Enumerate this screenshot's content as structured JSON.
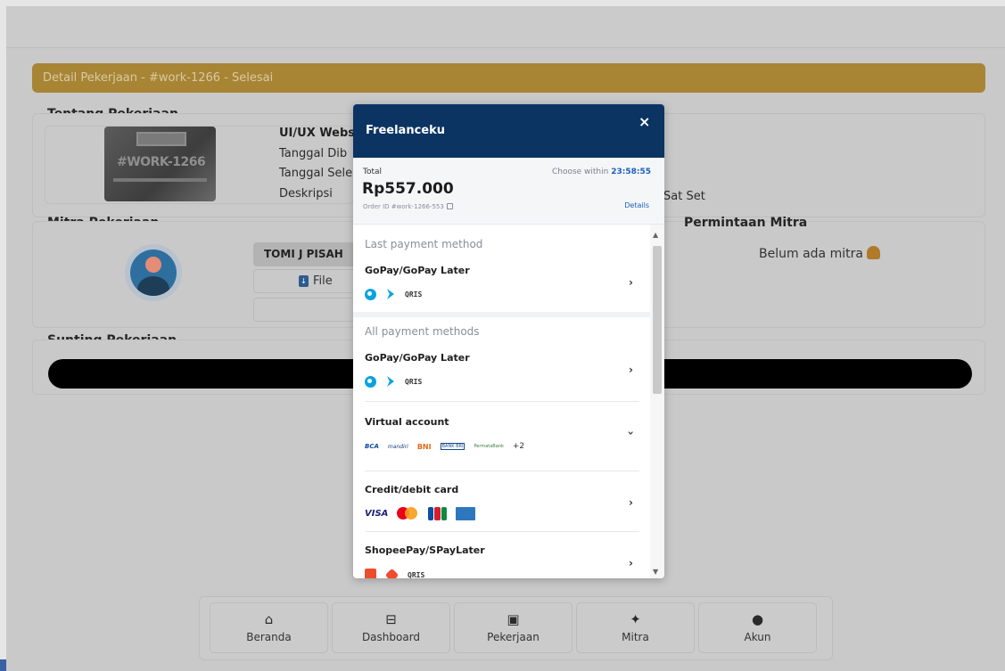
{
  "header": {
    "title": "Detail Pekerjaan - #work-1266 - Selesai"
  },
  "about": {
    "section_title": "Tentang Pekerjaan",
    "thumbnail_watermark": "#WORK-1266",
    "job_title": "UI/UX Webs",
    "date_created_label": "Tanggal Dib",
    "date_finished_label": "Tanggal Sele",
    "description_label": "Deskripsi",
    "description_tail": "Sat Set"
  },
  "partner": {
    "section_title": "Mitra Pekerjaan",
    "name": "TOMI J PISAH",
    "file_label": "File"
  },
  "requests": {
    "section_title": "Permintaan Mitra",
    "empty_text": "Belum ada mitra"
  },
  "edit": {
    "section_title": "Sunting Pekerjaan"
  },
  "bottom_nav": [
    {
      "label": "Beranda",
      "icon": "home-icon"
    },
    {
      "label": "Dashboard",
      "icon": "dashboard-icon"
    },
    {
      "label": "Pekerjaan",
      "icon": "briefcase-icon"
    },
    {
      "label": "Mitra",
      "icon": "handshake-icon"
    },
    {
      "label": "Akun",
      "icon": "account-icon"
    }
  ],
  "modal": {
    "merchant": "Freelanceku",
    "close_label": "×",
    "total_label": "Total",
    "choose_within_label": "Choose within",
    "countdown": "23:58:55",
    "amount": "Rp557.000",
    "order_id": "Order ID #work-1266-553",
    "details_label": "Details",
    "last_payment_label": "Last payment method",
    "all_payment_label": "All payment methods",
    "methods": {
      "gopay_last": "GoPay/GoPay Later",
      "gopay_all": "GoPay/GoPay Later",
      "virtual_account": "Virtual account",
      "credit_card": "Credit/debit card",
      "shopeepay": "ShopeePay/SPayLater"
    },
    "logos": {
      "qris": "QRIS",
      "bca": "BCA",
      "mandiri": "mandiri",
      "bni": "BNI",
      "bri": "BANK BRI",
      "permata": "PermataBank",
      "va_more": "+2",
      "visa": "VISA"
    }
  },
  "colors": {
    "header_gold": "#a88535",
    "modal_navy": "#0b3463",
    "link_blue": "#1a5fbf"
  }
}
